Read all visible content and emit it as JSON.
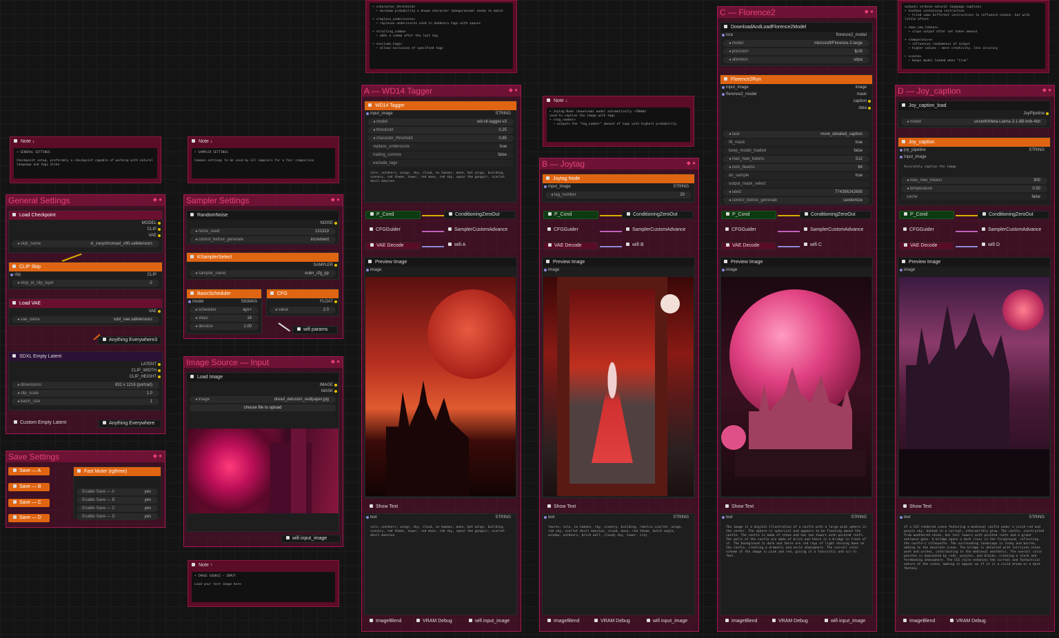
{
  "groups": {
    "general": "General Settings",
    "sampler": "Sampler Settings",
    "image_source": "Image Source — Input",
    "save": "Save Settings",
    "wd14": "A — WD14 Tagger",
    "joytag": "B — Joytag",
    "florence": "C — Florence2",
    "joycap": "D — Joy_caption"
  },
  "notes": {
    "n1_title": "Note ↓",
    "n1_head": "• GENERAL SETTINGS",
    "n1_body": "Checkpoint setup, preferably a checkpoint capable of working with natural language and tags alike",
    "n2_title": "Note ↓",
    "n2_head": "• SAMPLER SETTINGS",
    "n2_body": "Common settings to be used by all samplers for a fair comparison",
    "n3_title": "Note ↑",
    "n3_head": "• IMAGE SOURCE — INPUT",
    "n3_body": "Load your test image here",
    "n4_title": "Note ↓",
    "n4_body": "• Joytag Node (downloads model automatically ~700mb)\nused to caption the image with tags\n• <tag_number>\n  ~ outputs the \"tag_number\" amount of tags with highest probability",
    "n5_body": "• <character_threshold>\n  ~ minimum probability a known character (manga/anime) needs to match\n\n• <replace_underscores>\n  ~ replaces underscores used in danbooru tags with spaces\n\n• <trailing_comma>\n  ~ adds a comma after the last tag\n\n• <exclude_tags>\n  ~ allows exclusion of specified tags",
    "n6_body": "outputs verbose natural language captions\n• textbox containing instruction\n  ~ tried some different instructions to influence output, but with little effect\n\n• <max_new_tokens>\n  ~ crops output after set token amount\n\n• <temperature>\n  ~ influences randomness of output\n  ~ higher values : more creativity, less accuracy\n\n• <cache>\n  ~ keeps model loaded when \"true\""
  },
  "general": {
    "load_ckpt": "Load Checkpoint",
    "model": "MODEL",
    "clip": "CLIP",
    "vae": "VAE",
    "ckpt_name": "ckpt_name",
    "ckpt_val": "xl_zavychromaxl_v90.safetensors",
    "clip_skip": "CLIP Skip",
    "clip_in": "clip",
    "clip_out": "CLIP",
    "stop_at": "stop_at_clip_layer",
    "stop_val": "-2",
    "load_vae": "Load VAE",
    "vae_out": "VAE",
    "vae_name": "vae_name",
    "vae_val": "sdxl_vae.safetensors",
    "anything3": "Anything Everywhere3",
    "sdxl_latent": "SDXL Empty Latent",
    "latent": "LATENT",
    "clip_width": "CLIP_WIDTH",
    "clip_height": "CLIP_HEIGHT",
    "dimensions": "dimensions",
    "dim_val": "832 x 1216 (portrait)",
    "clip_scale": "clip_scale",
    "clip_scale_val": "1.0",
    "batch_size": "batch_size",
    "batch_val": "1",
    "custom_latent": "Custom Empty Latent",
    "anything": "Anything Everywhere"
  },
  "sampler": {
    "random_noise": "RandomNoise",
    "noise": "NOISE",
    "noise_seed": "noise_seed",
    "seed_val": "131313",
    "control": "control_before_generate",
    "control_val": "increment",
    "ksampler_select": "KSamplerSelect",
    "sampler_out": "SAMPLER",
    "sampler_name": "sampler_name",
    "sampler_val": "euler_cfg_pp",
    "basic_scheduler": "BasicScheduler",
    "sigmas": "SIGMAS",
    "model_in": "model",
    "scheduler": "scheduler",
    "scheduler_val": "ays+",
    "steps": "steps",
    "steps_val": "16",
    "denoise": "denoise",
    "denoise_val": "1.00",
    "cfg": "CFG",
    "float": "FLOAT",
    "value": "value",
    "value_val": "2.0",
    "wifi_params": "wifi params"
  },
  "image_source": {
    "load_image": "Load Image",
    "image": "IMAGE",
    "mask": "MASK",
    "image_w": "image",
    "image_val": "dread_delusion_wallpaper.jpg",
    "upload": "choose file to upload",
    "wifi": "wifi input_image"
  },
  "save": {
    "save_a": "Save — A",
    "save_b": "Save — B",
    "save_c": "Save — C",
    "save_d": "Save — D",
    "muter": "Fast Muter (rgthree)",
    "en_a": "Enable Save — A",
    "en_b": "Enable Save — B",
    "en_c": "Enable Save — C",
    "en_d": "Enable Save — D",
    "yes": "yes"
  },
  "common": {
    "p_cond": "P_Cond",
    "cond_zero": "ConditioningZeroOut",
    "cfg_guider": "CFGGuider",
    "sampler_adv": "SamplerCustomAdvance",
    "vae_decode": "VAE Decode",
    "preview": "Preview Image",
    "image_in": "image",
    "show_text": "Show Text",
    "text_in": "text",
    "string": "STRING",
    "image_blend": "ImageBlend",
    "vram": "VRAM Debug",
    "wifi_input": "wifi input_image"
  },
  "wd14": {
    "node": "WD14 Tagger",
    "input": "input_image",
    "string": "STRING",
    "model": "model",
    "model_val": "wd-vit-tagger-v3",
    "threshold": "threshold",
    "threshold_val": "0.25",
    "char_th": "character_threshold",
    "char_val": "0.85",
    "replace": "replace_underscore",
    "replace_val": "true",
    "trailing": "trailing_comma",
    "trailing_val": "false",
    "exclude": "exclude_tags",
    "tags": "solo, outdoors, wings, sky, cloud, no humans, moon, bat wings, building, scenery, red theme, tower, red moon, red sky, spear the gungnir, scarlet devil mansion",
    "wifi_a": "wifi A"
  },
  "joytag": {
    "node": "Joytag Node",
    "input": "input_image",
    "string": "STRING",
    "tag_number": "tag_number",
    "tag_val": "20",
    "wifi_b": "wifi B",
    "tags": "lowres, solo, no humans, sky, scenery, building, remilia scarlet, wings, red sky, scarlet devil mansion, cloud, moon, red theme, dutch angle, window, outdoors, brick wall, cloudy sky, tower, city"
  },
  "florence": {
    "download": "DownloadAndLoadFlorence2Model",
    "lora": "lora",
    "model_out": "florence2_model",
    "model": "model",
    "model_val": "microsoft/Florence-2-large",
    "precision": "precision",
    "precision_val": "fp16",
    "attention": "attention",
    "attention_val": "sdpa",
    "run": "Florence2Run",
    "input": "input_image",
    "model_in": "florence2_model",
    "o_image": "image",
    "o_mask": "mask",
    "o_caption": "caption",
    "o_data": "data",
    "task": "task",
    "task_val": "more_detailed_caption",
    "fill_mask": "fill_mask",
    "fill_val": "true",
    "keep": "keep_model_loaded",
    "keep_val": "false",
    "max_tokens": "max_new_tokens",
    "max_val": "512",
    "beams": "num_beams",
    "beams_val": "64",
    "sample": "do_sample",
    "sample_val": "true",
    "output_mask": "output_mask_select",
    "seed": "seed",
    "seed_val": "774396242685",
    "control": "control_before_generate",
    "control_val": "randomize",
    "wifi_c": "wifi C",
    "caption": "The image is a digital illustration of a castle with a large pink sphere in the center. The sphere is spherical and appears to be floating above the castle. The castle is made of stone and has two towers with pointed roofs. The walls of the castle are made of brick and there is a bridge in front of it. The background is dark and there are red rays of light shining down on the castle, creating a dramatic and eerie atmosphere. The overall color scheme of the image is pink and red, giving it a futuristic and sci-fi feel."
  },
  "joycap": {
    "load": "Joy_caption_load",
    "pipeline": "JoyPipeline",
    "model": "model",
    "model_val": "unsloth/Meta-Llama-3.1-8B-bnb-4bit",
    "node": "Joy_caption",
    "pipe_in": "joy_pipeline",
    "input": "input_image",
    "string": "STRING",
    "prompt": "Accurately caption the image",
    "max_tokens": "max_new_tokens",
    "max_val": "300",
    "temperature": "temperature",
    "temp_val": "0.50",
    "cache": "cache",
    "cache_val": "false",
    "wifi_d": "wifi D",
    "caption": "of a CGI-rendered scene featuring a medieval castle under a vivid red and purple sky, bathed in a surreal, otherworldly glow. The castle, constructed from weathered stone, has tall towers with pointed roofs and a grand entrance gate. A bridge spans a dark river in the foreground, reflecting the castle's silhouette. The surrounding landscape is rocky and barren, adding to the desolate scene. The bridge is detailed with intricate stone work and arches, contributing to the medieval aesthetic. The overall color palette is dominated by reds, purples, and blacks, creating a stark and foreboding atmosphere. The CGI style enhances the surreal and fantastical nature of the scene, making it appear as if it is a vivid dream or a dark fantasy."
  }
}
